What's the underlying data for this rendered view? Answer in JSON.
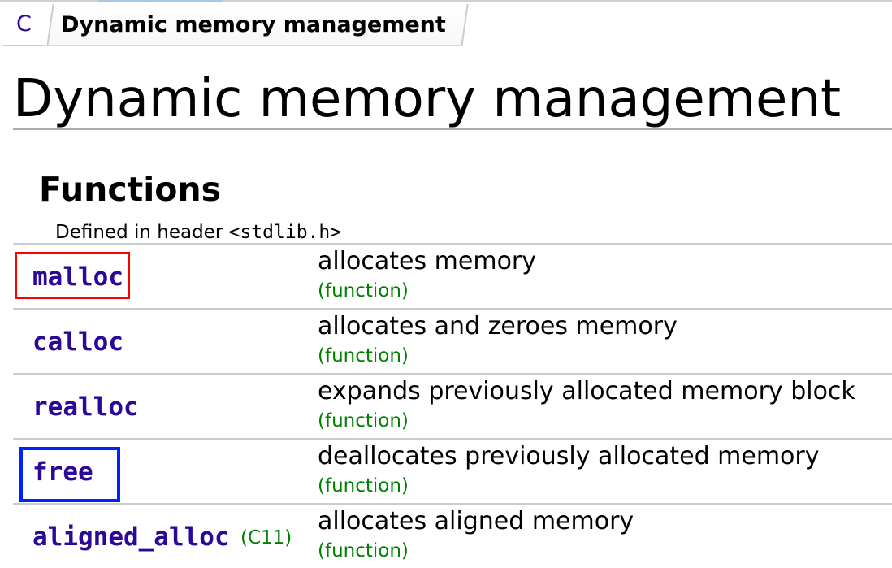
{
  "breadcrumb": {
    "parent": "C",
    "current": "Dynamic memory management"
  },
  "page": {
    "title": "Dynamic memory management",
    "section": "Functions",
    "header_note_prefix": "Defined in header ",
    "header_file": "<stdlib.h>"
  },
  "functions": [
    {
      "name": "malloc",
      "description": "allocates memory",
      "kind": "(function)"
    },
    {
      "name": "calloc",
      "description": "allocates and zeroes memory",
      "kind": "(function)"
    },
    {
      "name": "realloc",
      "description": "expands previously allocated memory block",
      "kind": "(function)"
    },
    {
      "name": "free",
      "description": "deallocates previously allocated memory",
      "kind": "(function)"
    },
    {
      "name": "aligned_alloc",
      "std_tag": "(C11)",
      "description": "allocates aligned memory",
      "kind": "(function)"
    }
  ],
  "highlights": {
    "malloc_box_color": "#ff0000",
    "free_box_color": "#0022ff"
  },
  "colors": {
    "link": "#2c0899",
    "kind": "#008000"
  }
}
